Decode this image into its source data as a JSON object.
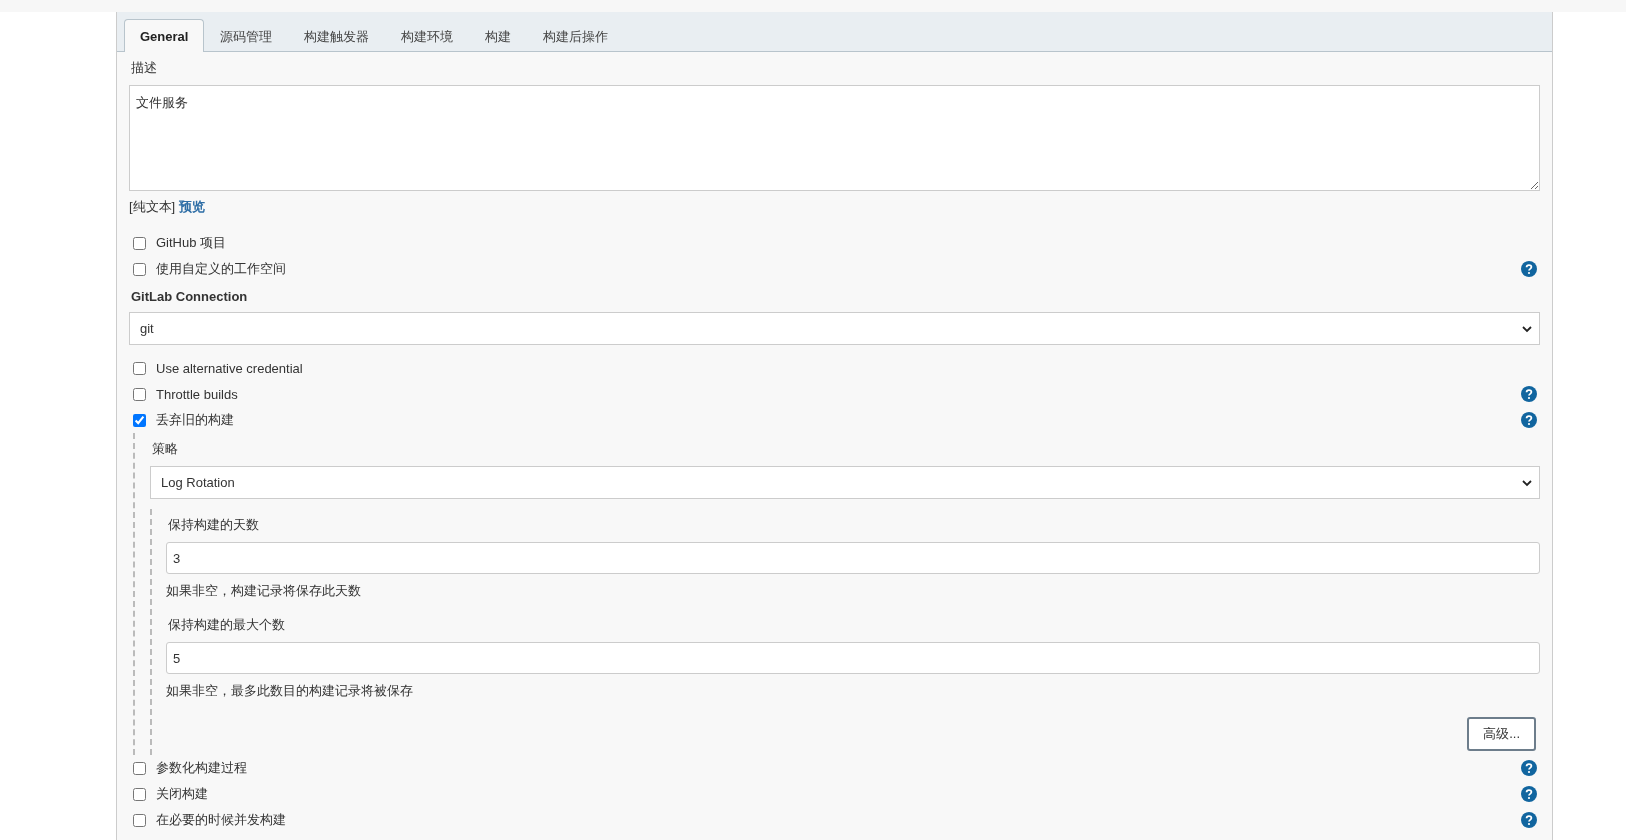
{
  "tabs": [
    {
      "label": "General",
      "selected": true
    },
    {
      "label": "源码管理",
      "selected": false
    },
    {
      "label": "构建触发器",
      "selected": false
    },
    {
      "label": "构建环境",
      "selected": false
    },
    {
      "label": "构建",
      "selected": false
    },
    {
      "label": "构建后操作",
      "selected": false
    }
  ],
  "description": {
    "label": "描述",
    "value": "文件服务",
    "format": "[纯文本]",
    "preview_link": "预览"
  },
  "options": [
    {
      "kind": "checkbox",
      "label": "GitHub 项目",
      "checked": false,
      "help": false
    },
    {
      "kind": "checkbox",
      "label": "使用自定义的工作空间",
      "checked": false,
      "help": true
    },
    {
      "kind": "select",
      "label": "GitLab Connection",
      "value": "git"
    },
    {
      "kind": "checkbox",
      "label": "Use alternative credential",
      "checked": false,
      "help": false
    },
    {
      "kind": "checkbox",
      "label": "Throttle builds",
      "checked": false,
      "help": true
    },
    {
      "kind": "checkbox",
      "label": "丢弃旧的构建",
      "checked": true,
      "help": true,
      "details": {
        "label": "策略",
        "value": "Log Rotation",
        "fields": [
          {
            "label": "保持构建的天数",
            "value": "3",
            "hint": "如果非空，构建记录将保存此天数"
          },
          {
            "label": "保持构建的最大个数",
            "value": "5",
            "hint": "如果非空，最多此数目的构建记录将被保存"
          }
        ],
        "advanced_button": "高级..."
      }
    },
    {
      "kind": "checkbox",
      "label": "参数化构建过程",
      "checked": false,
      "help": true
    },
    {
      "kind": "checkbox",
      "label": "关闭构建",
      "checked": false,
      "help": true
    },
    {
      "kind": "checkbox",
      "label": "在必要的时候并发构建",
      "checked": false,
      "help": true
    }
  ]
}
